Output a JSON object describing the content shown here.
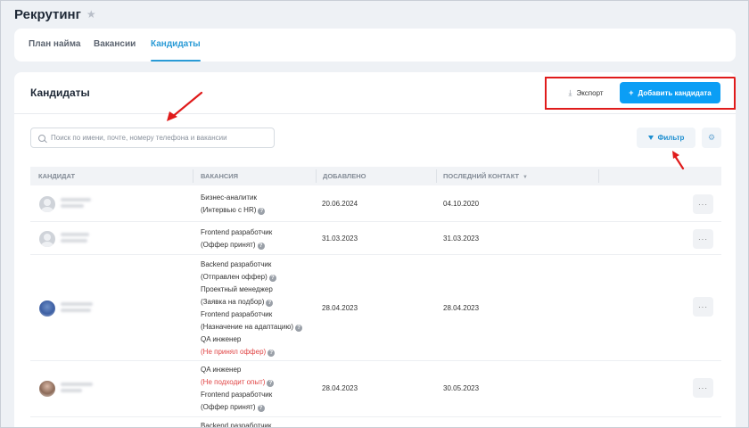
{
  "page": {
    "title": "Рекрутинг"
  },
  "tabs": [
    {
      "label": "План найма"
    },
    {
      "label": "Вакансии"
    },
    {
      "label": "Кандидаты"
    }
  ],
  "card": {
    "title": "Кандидаты"
  },
  "toolbar": {
    "export_label": "Экспорт",
    "add_label": "Добавить кандидата",
    "filter_label": "Фильтр"
  },
  "search": {
    "placeholder": "Поиск по имени, почте, номеру телефона и вакансии"
  },
  "columns": [
    "КАНДИДАТ",
    "ВАКАНСИЯ",
    "ДОБАВЛЕНО",
    "ПОСЛЕДНИЙ КОНТАКТ"
  ],
  "rows": [
    {
      "vacancies": [
        {
          "title": "Бизнес-аналитик",
          "status": "(Интервью с HR)"
        }
      ],
      "added": "20.06.2024",
      "last_contact": "04.10.2020"
    },
    {
      "vacancies": [
        {
          "title": "Frontend разработчик",
          "status": "(Оффер принят)"
        }
      ],
      "added": "31.03.2023",
      "last_contact": "31.03.2023"
    },
    {
      "vacancies": [
        {
          "title": "Backend разработчик",
          "status": "(Отправлен оффер)"
        },
        {
          "title": "Проектный менеджер",
          "status": "(Заявка на подбор)"
        },
        {
          "title": "Frontend разработчик",
          "status": "(Назначение на адаптацию)"
        },
        {
          "title": "QA инженер",
          "status": "(Не принял оффер)"
        }
      ],
      "added": "28.04.2023",
      "last_contact": "28.04.2023"
    },
    {
      "vacancies": [
        {
          "title": "QA инженер",
          "status": "(Не подходит опыт)"
        },
        {
          "title": "Frontend разработчик",
          "status": "(Оффер принят)"
        }
      ],
      "added": "28.04.2023",
      "last_contact": "30.05.2023"
    },
    {
      "vacancies": [
        {
          "title": "Backend разработчик",
          "status": ""
        }
      ],
      "added": "",
      "last_contact": ""
    }
  ],
  "colors": {
    "accent": "#0b9ef5",
    "tab_active": "#2a9bd6",
    "annotation": "#e01b1b",
    "status_negative": "#e04444"
  },
  "icons": {
    "favorite": "star-icon",
    "export": "download-icon",
    "add": "plus-icon",
    "search": "search-icon",
    "filter": "funnel-icon",
    "settings": "gear-icon",
    "sort": "chevron-down-icon",
    "help": "help-icon",
    "more": "more-icon"
  }
}
